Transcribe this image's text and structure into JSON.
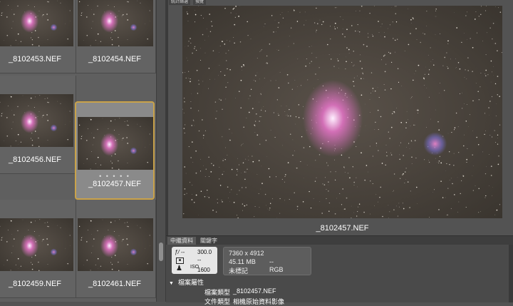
{
  "top_tabs": [
    "統計篩選",
    "預覽"
  ],
  "thumbnails": [
    {
      "file": "_8102453.NEF",
      "selected": false
    },
    {
      "file": "_8102454.NEF",
      "selected": false
    },
    {
      "file": "_8102456.NEF",
      "selected": false
    },
    {
      "file": "_8102457.NEF",
      "selected": true
    },
    {
      "file": "_8102459.NEF",
      "selected": false
    },
    {
      "file": "_8102461.NEF",
      "selected": false
    }
  ],
  "selection_dots": "• • • • •",
  "preview": {
    "file": "_8102457.NEF"
  },
  "metadata": {
    "tabs": [
      "中繼資料",
      "關鍵字"
    ],
    "exif": {
      "aperture": "ƒ/ --",
      "shutter": "300.0",
      "exposure_comp": "--",
      "iso_label": "ISO",
      "iso": "1600"
    },
    "info": {
      "dimensions": "7360 x 4912",
      "size": "45.11 MB",
      "dash": "--",
      "label": "未標記",
      "color_mode": "RGB"
    },
    "section_title": "檔案屬性",
    "properties": [
      {
        "label": "檔案類型",
        "value": "_8102457.NEF"
      },
      {
        "label": "文件類型",
        "value": "相機原始資料影像"
      }
    ]
  },
  "colors": {
    "accent_selection": "#c9a24a",
    "nebula": "#d26fb6"
  }
}
